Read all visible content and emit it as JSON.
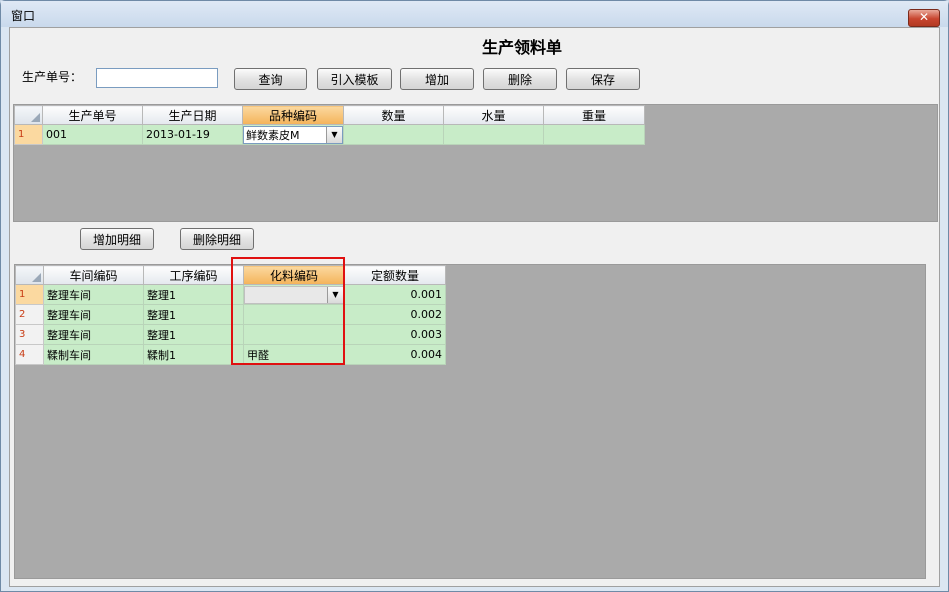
{
  "window": {
    "title": "窗口",
    "close_label": "✕"
  },
  "form": {
    "title": "生产领料单",
    "order_label": "生产单号：",
    "order_value": ""
  },
  "toolbar": {
    "query": "查询",
    "import_template": "引入模板",
    "add": "增加",
    "delete": "删除",
    "save": "保存"
  },
  "master_grid": {
    "headers": [
      "生产单号",
      "生产日期",
      "品种编码",
      "数量",
      "水量",
      "重量"
    ],
    "rows": [
      {
        "num": "1",
        "order_no": "001",
        "date": "2013-01-19",
        "variety": "鲜数素皮M",
        "qty": "",
        "water": "",
        "weight": ""
      }
    ]
  },
  "detail_buttons": {
    "add": "增加明细",
    "delete": "删除明细"
  },
  "detail_grid": {
    "headers": [
      "车间编码",
      "工序编码",
      "化料编码",
      "定额数量"
    ],
    "rows": [
      {
        "num": "1",
        "workshop": "整理车间",
        "process": "整理1",
        "chem": "",
        "quota": "0.001"
      },
      {
        "num": "2",
        "workshop": "整理车间",
        "process": "整理1",
        "chem": "",
        "quota": "0.002"
      },
      {
        "num": "3",
        "workshop": "整理车间",
        "process": "整理1",
        "chem": "",
        "quota": "0.003"
      },
      {
        "num": "4",
        "workshop": "鞣制车间",
        "process": "鞣制1",
        "chem": "甲醛",
        "quota": "0.004"
      }
    ]
  },
  "colors": {
    "grid_bg": "#aaaaaa",
    "row_green": "#c8ecc8",
    "header_selected": "#f4b35a",
    "highlight_box": "#e01010"
  }
}
